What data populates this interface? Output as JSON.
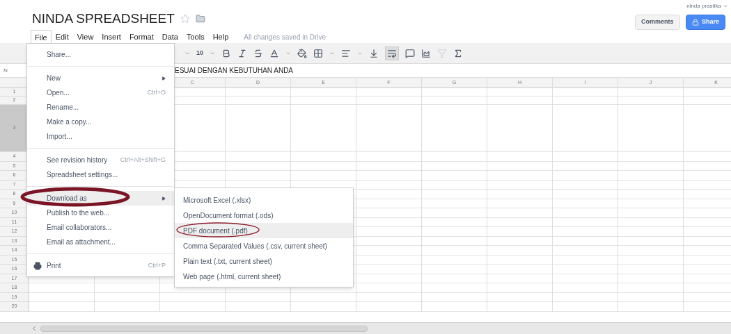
{
  "document": {
    "title": "NINDA SPREADSHEET",
    "starred": false
  },
  "user": {
    "name": "ninda prastika"
  },
  "buttons": {
    "comments": "Comments",
    "share": "Share"
  },
  "menubar": [
    {
      "label": "File",
      "selected": true
    },
    {
      "label": "Edit",
      "selected": false
    },
    {
      "label": "View",
      "selected": false
    },
    {
      "label": "Insert",
      "selected": false
    },
    {
      "label": "Format",
      "selected": false
    },
    {
      "label": "Data",
      "selected": false
    },
    {
      "label": "Tools",
      "selected": false
    },
    {
      "label": "Help",
      "selected": false
    }
  ],
  "save_status": "All changes saved in Drive",
  "toolbar": {
    "font_size": "10"
  },
  "formula_bar": {
    "label": "fx",
    "value": "ESUAI DENGAN KEBUTUHAN ANDA"
  },
  "sheet": {
    "columns": [
      "C",
      "D",
      "E",
      "F",
      "G",
      "H",
      "I",
      "J",
      "K"
    ],
    "rows": [
      {
        "label": "1",
        "selected": false
      },
      {
        "label": "2",
        "selected": false
      },
      {
        "label": "3",
        "selected": true
      },
      {
        "label": "4",
        "selected": false
      },
      {
        "label": "5",
        "selected": false
      },
      {
        "label": "6",
        "selected": false
      },
      {
        "label": "7",
        "selected": false
      },
      {
        "label": "8",
        "selected": false
      },
      {
        "label": "9",
        "selected": false
      },
      {
        "label": "10",
        "selected": false
      },
      {
        "label": "11",
        "selected": false
      },
      {
        "label": "12",
        "selected": false
      },
      {
        "label": "13",
        "selected": false
      },
      {
        "label": "14",
        "selected": false
      },
      {
        "label": "15",
        "selected": false
      },
      {
        "label": "16",
        "selected": false
      },
      {
        "label": "17",
        "selected": false
      },
      {
        "label": "18",
        "selected": false
      },
      {
        "label": "19",
        "selected": false
      },
      {
        "label": "20",
        "selected": false
      }
    ]
  },
  "file_menu": [
    {
      "kind": "item",
      "label": "Share...",
      "selected": false,
      "submenu": false,
      "icon": false
    },
    {
      "kind": "separator"
    },
    {
      "kind": "item",
      "label": "New",
      "selected": false,
      "submenu": true,
      "icon": false
    },
    {
      "kind": "item",
      "label": "Open...",
      "shortcut": "Ctrl+O",
      "selected": false,
      "submenu": false,
      "icon": false
    },
    {
      "kind": "item",
      "label": "Rename...",
      "selected": false,
      "submenu": false,
      "icon": false
    },
    {
      "kind": "item",
      "label": "Make a copy...",
      "selected": false,
      "submenu": false,
      "icon": false
    },
    {
      "kind": "item",
      "label": "Import...",
      "selected": false,
      "submenu": false,
      "icon": false
    },
    {
      "kind": "separator"
    },
    {
      "kind": "item",
      "label": "See revision history",
      "shortcut": "Ctrl+Alt+Shift+G",
      "selected": false,
      "submenu": false,
      "icon": false
    },
    {
      "kind": "item",
      "label": "Spreadsheet settings...",
      "selected": false,
      "submenu": false,
      "icon": false
    },
    {
      "kind": "separator"
    },
    {
      "kind": "item",
      "label": "Download as",
      "selected": true,
      "submenu": true,
      "icon": false
    },
    {
      "kind": "item",
      "label": "Publish to the web...",
      "selected": false,
      "submenu": false,
      "icon": false
    },
    {
      "kind": "item",
      "label": "Email collaborators...",
      "selected": false,
      "submenu": false,
      "icon": false
    },
    {
      "kind": "item",
      "label": "Email as attachment...",
      "selected": false,
      "submenu": false,
      "icon": false
    },
    {
      "kind": "separator"
    },
    {
      "kind": "item",
      "label": "Print",
      "shortcut": "Ctrl+P",
      "selected": false,
      "submenu": false,
      "icon": true
    }
  ],
  "download_menu": [
    {
      "label": "Microsoft Excel (.xlsx)",
      "selected": false
    },
    {
      "label": "OpenDocument format (.ods)",
      "selected": false
    },
    {
      "label": "PDF document (.pdf)",
      "selected": true
    },
    {
      "label": "Comma Separated Values (.csv, current sheet)",
      "selected": false
    },
    {
      "label": "Plain text (.txt, current sheet)",
      "selected": false
    },
    {
      "label": "Web page (.html, current sheet)",
      "selected": false
    }
  ]
}
